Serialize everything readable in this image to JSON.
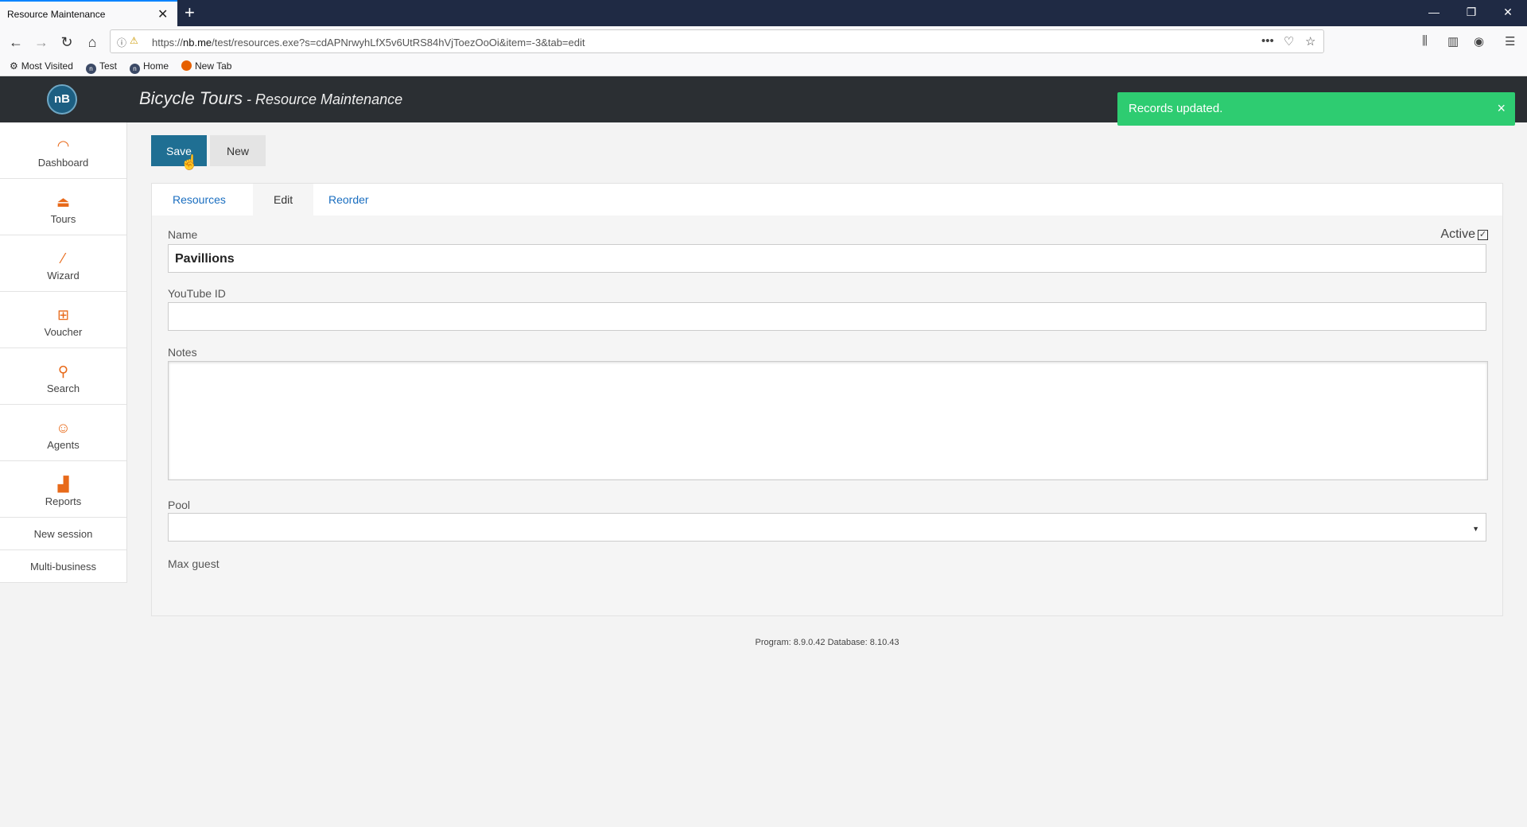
{
  "browser": {
    "tab_title": "Resource Maintenance",
    "tab_close": "✕",
    "new_tab": "+",
    "url_prefix": "https://",
    "url_host": "nb.me",
    "url_path": "/test/resources.exe?s=cdAPNrwyhLfX5v6UtRS84hVjToezOoOi&item=-3&tab=edit",
    "bookmarks": [
      "Most Visited",
      "Test",
      "Home",
      "New Tab"
    ]
  },
  "app": {
    "logo": "nB",
    "title": "Bicycle Tours",
    "subtitle": " - Resource Maintenance"
  },
  "toast": {
    "text": "Records updated.",
    "close": "×",
    "color": "#2ecc71"
  },
  "sidebar": {
    "items": [
      {
        "label": "Dashboard",
        "icon": "dashboard-icon"
      },
      {
        "label": "Tours",
        "icon": "hanger-icon"
      },
      {
        "label": "Wizard",
        "icon": "wand-icon"
      },
      {
        "label": "Voucher",
        "icon": "gift-icon"
      },
      {
        "label": "Search",
        "icon": "search-icon"
      },
      {
        "label": "Agents",
        "icon": "agent-icon"
      },
      {
        "label": "Reports",
        "icon": "chart-icon"
      }
    ],
    "links": [
      "New session",
      "Multi-business"
    ]
  },
  "toolbar": {
    "save_label": "Save",
    "new_label": "New"
  },
  "tabs": [
    "Resources",
    "Edit",
    "Reorder"
  ],
  "form": {
    "name_label": "Name",
    "name_value": "Pavillions",
    "active_label": "Active",
    "active_checked": true,
    "youtube_label": "YouTube ID",
    "youtube_value": "",
    "notes_label": "Notes",
    "notes_value": "",
    "pool_label": "Pool",
    "pool_value": "",
    "max_guest_label": "Max guest"
  },
  "footer": {
    "text": "Program: 8.9.0.42 Database: 8.10.43"
  },
  "colors": {
    "header_bg": "#2b2f33",
    "accent": "#1f6f93",
    "icon_orange": "#e86a1a"
  }
}
